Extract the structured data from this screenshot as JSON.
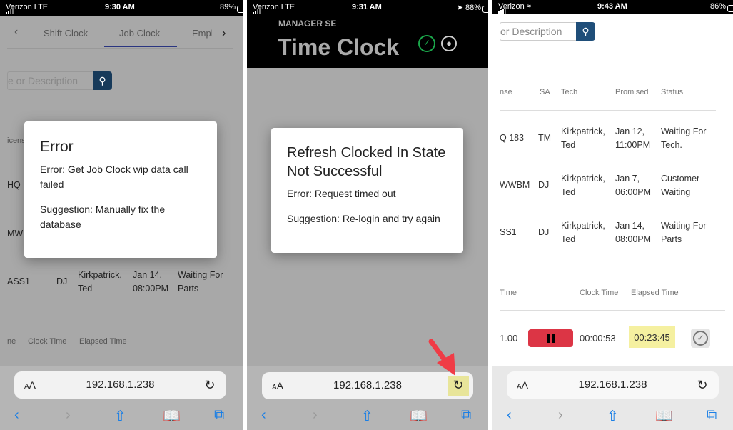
{
  "panels": [
    {
      "status": {
        "carrier": "Verizon",
        "network": "LTE",
        "time": "9:30 AM",
        "battery": "89%"
      },
      "tabs": [
        {
          "label": "Shift Clock"
        },
        {
          "label": "Job Clock",
          "active": true
        },
        {
          "label": "Empl"
        }
      ],
      "search_placeholder": "e or Description",
      "table": {
        "partial_header": "icens",
        "rows": [
          {
            "license": "HQ"
          },
          {
            "license": "MW"
          },
          {
            "license": "ASS1",
            "sa": "DJ",
            "tech": "Kirkpatrick, Ted",
            "promised": "Jan 14, 08:00PM",
            "status": "Waiting For Parts"
          }
        ]
      },
      "clock_header": {
        "time": "ne",
        "clock_time": "Clock Time",
        "elapsed_time": "Elapsed Time"
      },
      "dialog": {
        "title": "Error",
        "error": "Error: Get Job Clock wip data call failed",
        "suggestion": "Suggestion: Manually fix the database"
      },
      "url": "192.168.1.238"
    },
    {
      "status": {
        "carrier": "Verizon",
        "network": "LTE",
        "time": "9:31 AM",
        "battery": "88%"
      },
      "header": {
        "subtitle": "MANAGER SE",
        "title": "Time Clock"
      },
      "dialog": {
        "title": "Refresh Clocked In State Not Successful",
        "error": "Error: Request timed out",
        "suggestion": "Suggestion: Re-login and try again"
      },
      "url": "192.168.1.238",
      "highlight_color": "#e8e59a",
      "arrow_color": "#f03c46"
    },
    {
      "status": {
        "carrier": "Verizon",
        "time": "9:43 AM",
        "battery": "86%"
      },
      "search_placeholder": "or Description",
      "table": {
        "headers": {
          "license": "nse",
          "sa": "SA",
          "tech": "Tech",
          "promised": "Promised",
          "status": "Status"
        },
        "rows": [
          {
            "license": "Q 183",
            "sa": "TM",
            "tech": "Kirkpatrick, Ted",
            "promised": "Jan 12, 11:00PM",
            "status": "Waiting For Tech."
          },
          {
            "license": "WWBM",
            "sa": "DJ",
            "tech": "Kirkpatrick, Ted",
            "promised": "Jan 7, 06:00PM",
            "status": "Customer Waiting"
          },
          {
            "license": "SS1",
            "sa": "DJ",
            "tech": "Kirkpatrick, Ted",
            "promised": "Jan 14, 08:00PM",
            "status": "Waiting For Parts"
          }
        ]
      },
      "clock": {
        "headers": {
          "time": "Time",
          "clock_time": "Clock Time",
          "elapsed_time": "Elapsed Time"
        },
        "row": {
          "time": "1.00",
          "clock_time": "00:00:53",
          "elapsed_time": "00:23:45"
        }
      },
      "url": "192.168.1.238",
      "pause_color": "#dc3545",
      "elapsed_highlight": "#f5f0a0"
    }
  ],
  "toolbar": {
    "aa_small": "A",
    "aa_large": "A",
    "icons": [
      "back-icon",
      "forward-icon",
      "share-icon",
      "bookmarks-icon",
      "tabs-icon"
    ]
  }
}
